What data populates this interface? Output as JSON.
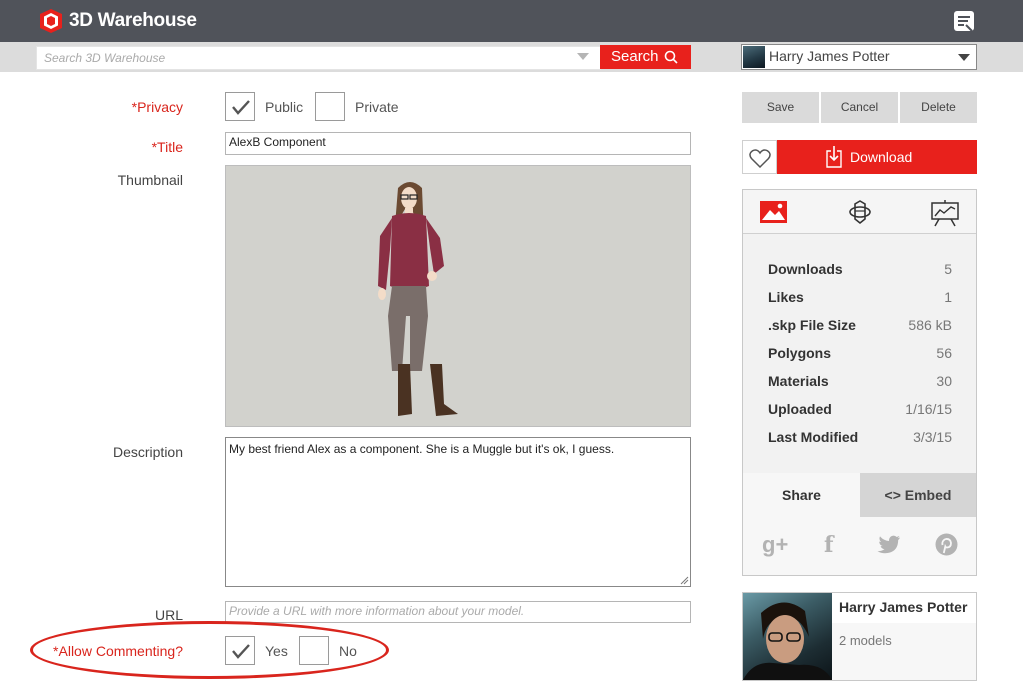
{
  "header": {
    "app_name": "3D Warehouse",
    "brand_color": "#e8211c",
    "bar_color": "#50535a"
  },
  "search": {
    "placeholder": "Search 3D Warehouse",
    "button_label": "Search"
  },
  "user_menu": {
    "name": "Harry James Potter"
  },
  "form": {
    "privacy": {
      "label": "*Privacy",
      "options": [
        {
          "label": "Public",
          "checked": true
        },
        {
          "label": "Private",
          "checked": false
        }
      ]
    },
    "title": {
      "label": "*Title",
      "value": "AlexB Component"
    },
    "thumbnail": {
      "label": "Thumbnail"
    },
    "description": {
      "label": "Description",
      "value": "My best friend Alex as a component. She is a Muggle but it's ok, I guess."
    },
    "url": {
      "label": "URL",
      "placeholder": "Provide a URL with more information about your model."
    },
    "commenting": {
      "label": "*Allow Commenting?",
      "options": [
        {
          "label": "Yes",
          "checked": true
        },
        {
          "label": "No",
          "checked": false
        }
      ]
    }
  },
  "actions": {
    "save": "Save",
    "cancel": "Cancel",
    "delete": "Delete",
    "download": "Download"
  },
  "stats_tabs": [
    "image-icon",
    "rotate-3d-icon",
    "presentation-icon"
  ],
  "stats": [
    {
      "key": "Downloads",
      "value": "5"
    },
    {
      "key": "Likes",
      "value": "1"
    },
    {
      "key": ".skp File Size",
      "value": "586 kB"
    },
    {
      "key": "Polygons",
      "value": "56"
    },
    {
      "key": "Materials",
      "value": "30"
    },
    {
      "key": "Uploaded",
      "value": "1/16/15"
    },
    {
      "key": "Last Modified",
      "value": "3/3/15"
    }
  ],
  "share": {
    "share_tab": "Share",
    "embed_tab": "<> Embed",
    "icons": [
      "google-plus-icon",
      "facebook-icon",
      "twitter-icon",
      "pinterest-icon"
    ]
  },
  "author": {
    "name": "Harry James Potter",
    "models": "2 models"
  }
}
